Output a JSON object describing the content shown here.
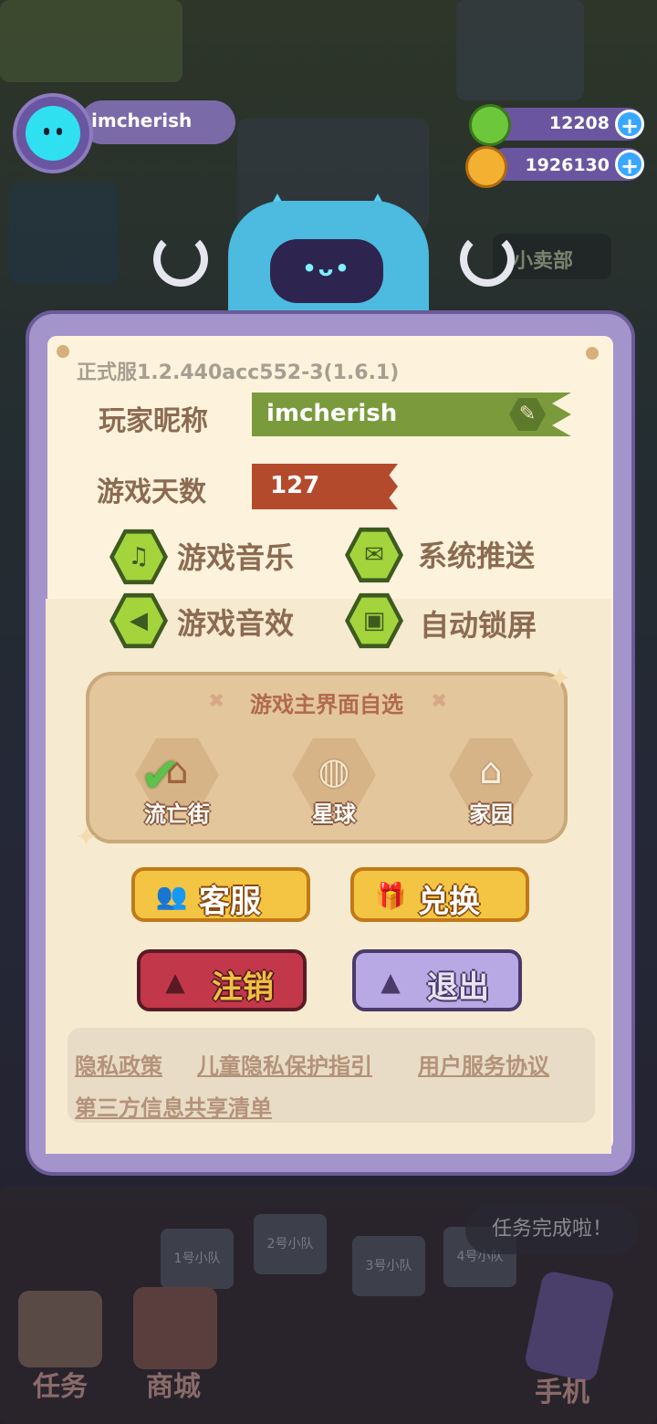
{
  "player": {
    "name": "imcherish"
  },
  "currency": {
    "gems": "12208",
    "coins": "1926130",
    "plus": "+"
  },
  "robot": {
    "eyes": "•ᴗ•"
  },
  "scene": {
    "shop_sign": "小卖部"
  },
  "panel": {
    "version": "正式服1.2.440acc552-3(1.6.1)",
    "nickname_label": "玩家昵称",
    "nickname_value": "imcherish",
    "days_label": "游戏天数",
    "days_value": "127"
  },
  "toggles": [
    {
      "label": "游戏音乐",
      "icon": "music-note-icon",
      "glyph": "♫"
    },
    {
      "label": "系统推送",
      "icon": "envelope-icon",
      "glyph": "✉"
    },
    {
      "label": "游戏音效",
      "icon": "speaker-icon",
      "glyph": "◀"
    },
    {
      "label": "自动锁屏",
      "icon": "lock-icon",
      "glyph": "▣"
    }
  ],
  "home_selector": {
    "title": "游戏主界面自选",
    "options": [
      {
        "label": "流亡街",
        "icon": "street-icon",
        "glyph": "⌂",
        "selected": true
      },
      {
        "label": "星球",
        "icon": "planet-icon",
        "glyph": "◍",
        "selected": false
      },
      {
        "label": "家园",
        "icon": "house-icon",
        "glyph": "⌂",
        "selected": false
      }
    ],
    "check": "✔"
  },
  "buttons": {
    "service": "客服",
    "redeem": "兑换",
    "logout": "注销",
    "exit": "退出"
  },
  "links": {
    "privacy": "隐私政策",
    "child_privacy": "儿童隐私保护指引",
    "user_agreement": "用户服务协议",
    "third_party": "第三方信息共享清单"
  },
  "squads": [
    "1号小队",
    "2号小队",
    "3号小队",
    "4号小队"
  ],
  "toast": "任务完成啦！",
  "nav": {
    "tasks": "任务",
    "shop": "商城",
    "phone": "手机"
  },
  "colors": {
    "panel_frame": "#a494cc",
    "paper": "#fdf3dc",
    "nickname_banner": "#7a9a3c",
    "days_banner": "#b44a2c",
    "toggle_on": "#a4d43c",
    "gold_button": "#f4c542",
    "red_button": "#c2384a",
    "purple_button": "#b8a8e4"
  }
}
